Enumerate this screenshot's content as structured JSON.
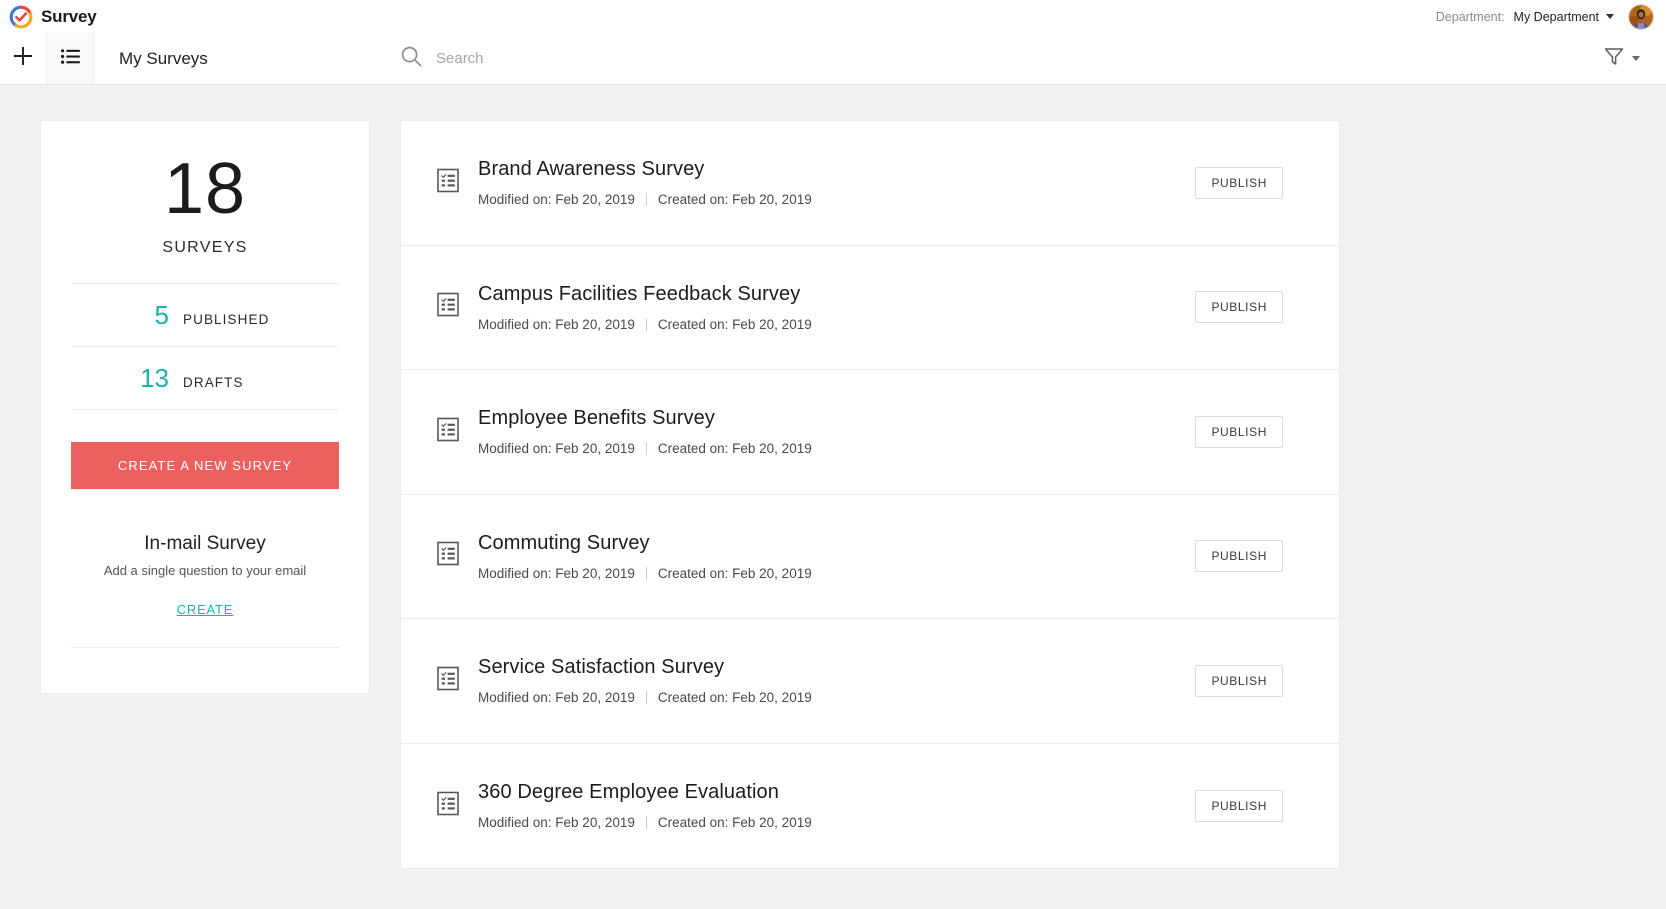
{
  "brand": {
    "name": "Survey",
    "logo_icon": "survey-check-logo"
  },
  "header": {
    "department_label": "Department:",
    "department_value": "My Department",
    "department_caret_icon": "chevron-down-icon",
    "avatar_icon": "user-avatar"
  },
  "toolbar": {
    "add_icon": "plus-icon",
    "list_view_icon": "list-view-icon",
    "title": "My Surveys",
    "search_icon": "search-icon",
    "search_value": "",
    "search_placeholder": "Search",
    "filter_icon": "funnel-filter-icon",
    "filter_caret_icon": "chevron-down-icon"
  },
  "sidebar": {
    "total_count": "18",
    "total_label": "SURVEYS",
    "stats": [
      {
        "count": "5",
        "label": "PUBLISHED"
      },
      {
        "count": "13",
        "label": "DRAFTS"
      }
    ],
    "cta_label": "CREATE A NEW SURVEY",
    "inmail_title": "In-mail Survey",
    "inmail_subtitle": "Add a single question to your email",
    "inmail_link_label": "CREATE"
  },
  "list": {
    "row_icon": "survey-form-icon",
    "modified_prefix": "Modified on:",
    "created_prefix": "Created on:",
    "publish_label": "PUBLISH",
    "items": [
      {
        "title": "Brand Awareness Survey",
        "modified": "Modified on: Feb 20, 2019",
        "created": "Created on: Feb 20, 2019",
        "action": "PUBLISH"
      },
      {
        "title": "Campus Facilities Feedback Survey",
        "modified": "Modified on: Feb 20, 2019",
        "created": "Created on: Feb 20, 2019",
        "action": "PUBLISH"
      },
      {
        "title": "Employee Benefits Survey",
        "modified": "Modified on: Feb 20, 2019",
        "created": "Created on: Feb 20, 2019",
        "action": "PUBLISH"
      },
      {
        "title": "Commuting Survey",
        "modified": "Modified on: Feb 20, 2019",
        "created": "Created on: Feb 20, 2019",
        "action": "PUBLISH"
      },
      {
        "title": "Service Satisfaction Survey",
        "modified": "Modified on: Feb 20, 2019",
        "created": "Created on: Feb 20, 2019",
        "action": "PUBLISH"
      },
      {
        "title": "360 Degree Employee Evaluation",
        "modified": "Modified on: Feb 20, 2019",
        "created": "Created on: Feb 20, 2019",
        "action": "PUBLISH"
      }
    ]
  },
  "colors": {
    "accent_teal": "#19b5ad",
    "cta_red": "#ec6060",
    "page_background": "#f2f2f2",
    "card_background": "#ffffff",
    "text_primary": "#1c1c1c"
  }
}
